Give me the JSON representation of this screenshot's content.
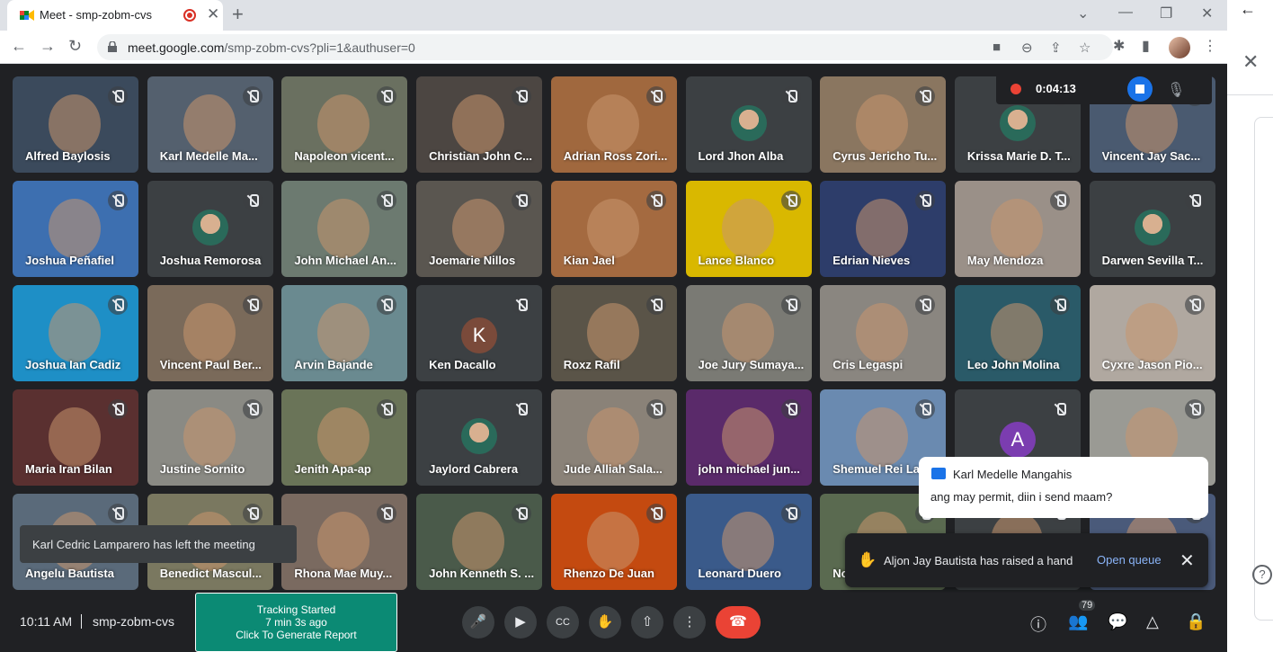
{
  "browser": {
    "tab_title": "Meet - smp-zobm-cvs",
    "url_host": "meet.google.com",
    "url_path": "/smp-zobm-cvs?pli=1&authuser=0",
    "new_tab_label": "+"
  },
  "recording": {
    "time": "0:04:13"
  },
  "participants": [
    {
      "name": "Alfred Baylosis",
      "bg": "#3b4a5c"
    },
    {
      "name": "Karl Medelle Ma...",
      "bg": "#54606e"
    },
    {
      "name": "Napoleon vicent...",
      "bg": "#6a7060"
    },
    {
      "name": "Christian John C...",
      "bg": "#4c4642"
    },
    {
      "name": "Adrian Ross Zori...",
      "bg": "#a0683e"
    },
    {
      "name": "Lord Jhon Alba",
      "bg": "#3c4043",
      "avatar": true
    },
    {
      "name": "Cyrus Jericho Tu...",
      "bg": "#8a7660"
    },
    {
      "name": "Krissa Marie D. T...",
      "bg": "#3c4043",
      "avatar": true
    },
    {
      "name": "Vincent Jay Sac...",
      "bg": "#4a5a70"
    },
    {
      "name": "Joshua Peñafiel",
      "bg": "#3d6fb0"
    },
    {
      "name": "Joshua Remorosa",
      "bg": "#3c4043",
      "avatar": true
    },
    {
      "name": "John Michael An...",
      "bg": "#6c7a70"
    },
    {
      "name": "Joemarie Nillos",
      "bg": "#5a5650"
    },
    {
      "name": "Kian Jael",
      "bg": "#a46a40"
    },
    {
      "name": "Lance Blanco",
      "bg": "#d9b800"
    },
    {
      "name": "Edrian Nieves",
      "bg": "#2d3d6a"
    },
    {
      "name": "May Mendoza",
      "bg": "#9a9088"
    },
    {
      "name": "Darwen Sevilla T...",
      "bg": "#3c4043",
      "avatar": true
    },
    {
      "name": "Joshua Ian Cadiz",
      "bg": "#1e8fc6"
    },
    {
      "name": "Vincent Paul Ber...",
      "bg": "#7a6a5a"
    },
    {
      "name": "Arvin Bajande",
      "bg": "#6a8a90"
    },
    {
      "name": "Ken Dacallo",
      "bg": "#3c4043",
      "initial": "K",
      "initial_color": "#7a4a3a"
    },
    {
      "name": "Roxz Rafil",
      "bg": "#5a5448"
    },
    {
      "name": "Joe Jury Sumaya...",
      "bg": "#7a7a74"
    },
    {
      "name": "Cris Legaspi",
      "bg": "#8a8680"
    },
    {
      "name": "Leo John Molina",
      "bg": "#2a5a68"
    },
    {
      "name": "Cyxre Jason Pio...",
      "bg": "#b0a8a0"
    },
    {
      "name": "Maria Iran Bilan",
      "bg": "#5a3030"
    },
    {
      "name": "Justine Sornito",
      "bg": "#8a8a84"
    },
    {
      "name": "Jenith Apa-ap",
      "bg": "#6a7458"
    },
    {
      "name": "Jaylord Cabrera",
      "bg": "#3c4043",
      "avatar": true
    },
    {
      "name": "Jude Alliah Sala...",
      "bg": "#8a8278"
    },
    {
      "name": "john michael jun...",
      "bg": "#5a2a6a"
    },
    {
      "name": "Shemuel Rei La...",
      "bg": "#6a8ab0"
    },
    {
      "name": "",
      "bg": "#3c4043",
      "initial": "A",
      "initial_color": "#7b3db0"
    },
    {
      "name": "",
      "bg": "#9a9a94"
    },
    {
      "name": "Angelu Bautista",
      "bg": "#5a6a7a"
    },
    {
      "name": "Benedict Mascul...",
      "bg": "#7a7860"
    },
    {
      "name": "Rhona Mae Muy...",
      "bg": "#7a6a60"
    },
    {
      "name": "John Kenneth S. ...",
      "bg": "#4a5a4a"
    },
    {
      "name": "Rhenzo De Juan",
      "bg": "#c44a10"
    },
    {
      "name": "Leonard Duero",
      "bg": "#3a5a8a"
    },
    {
      "name": "No...",
      "bg": "#5a6a50"
    },
    {
      "name": "",
      "bg": "#3c4043"
    },
    {
      "name": "",
      "bg": "#4a5a7a"
    }
  ],
  "toast": {
    "left_message": "Karl Cedric Lamparero has left the meeting"
  },
  "chat_popup": {
    "sender": "Karl Medelle Mangahis",
    "message": "ang may permit, diin i send maam?"
  },
  "raise_hand": {
    "message": "Aljon Jay Bautista has raised a hand",
    "action": "Open queue"
  },
  "bottom": {
    "time": "10:11 AM",
    "meeting_code": "smp-zobm-cvs",
    "tracking_line1": "Tracking Started",
    "tracking_line2": "7 min 3s ago",
    "tracking_line3": "Click To Generate Report",
    "participant_count": "79"
  },
  "icons": {
    "colors": {
      "end_call": "#ea4335",
      "accent_blue": "#1a73e8",
      "tracking_green": "#0b8a74"
    }
  }
}
